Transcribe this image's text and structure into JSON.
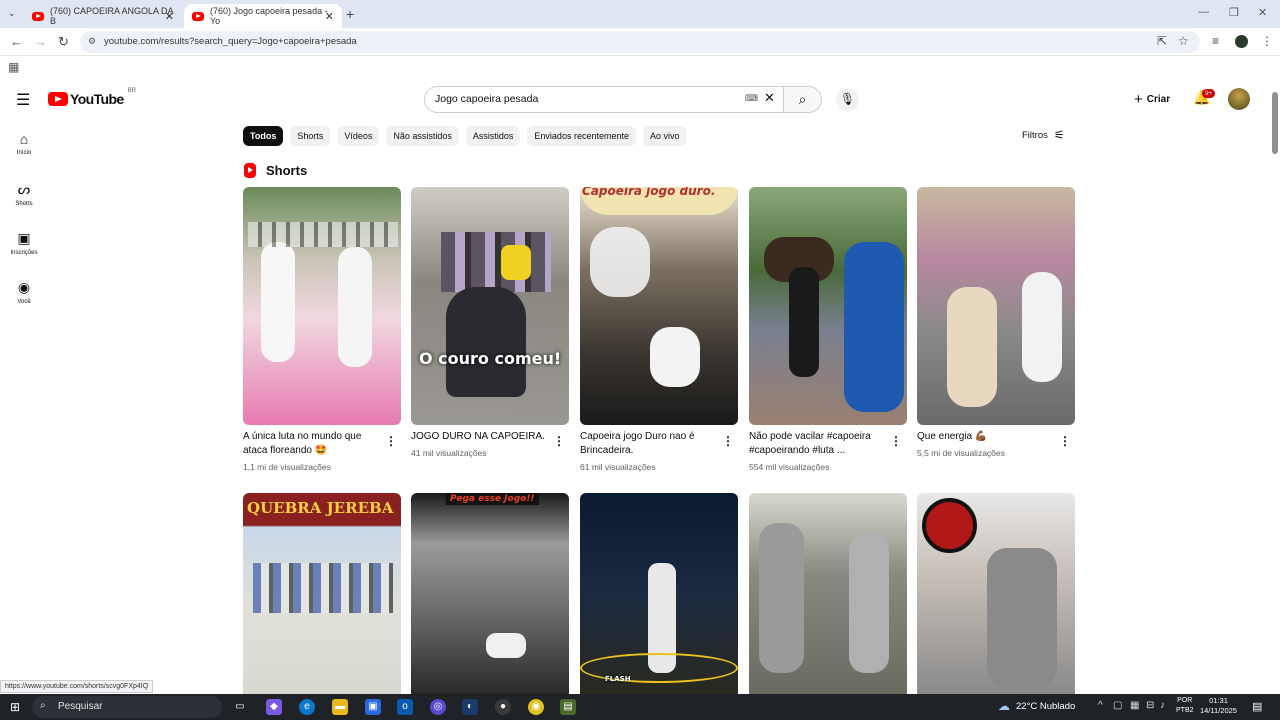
{
  "browser": {
    "tabs": [
      {
        "label": "(760) CAPOEIRA ANGOLA DA B",
        "favicon": "youtube-icon"
      },
      {
        "label": "(760) Jogo capoeira pesada - Yo",
        "favicon": "youtube-icon"
      }
    ],
    "url": "youtube.com/results?search_query=Jogo+capoeira+pesada"
  },
  "youtube": {
    "logo_text": "YouTube",
    "region": "BR",
    "search": {
      "value": "Jogo capoeira pesada"
    },
    "create_label": "Criar",
    "notification_badge": "9+"
  },
  "rail": [
    {
      "label": "Início",
      "icon": "home-icon"
    },
    {
      "label": "Shorts",
      "icon": "shorts-icon"
    },
    {
      "label": "Inscrições",
      "icon": "subscriptions-icon"
    },
    {
      "label": "Você",
      "icon": "you-icon"
    }
  ],
  "chips": [
    "Todos",
    "Shorts",
    "Vídeos",
    "Não assistidos",
    "Assistidos",
    "Enviados recentemente",
    "Ao vivo"
  ],
  "filters_label": "Filtros",
  "shorts_section_title": "Shorts",
  "shorts": [
    {
      "title": "A única luta no mundo que ataca floreando 🤩",
      "views": "1,1 mi de visualizações",
      "overlay": ""
    },
    {
      "title": "JOGO DURO NA CAPOEIRA.",
      "views": "41 mil visualizações",
      "overlay": "O couro comeu!"
    },
    {
      "title": "Capoeira jogo Duro nao é Brincadeira.",
      "views": "61 mil visualizações",
      "overlay": "Capoeira jogo duro."
    },
    {
      "title": "Não pode vacilar #capoeira #capoeirando #luta ...",
      "views": "554 mil visualizações",
      "overlay": ""
    },
    {
      "title": "Que energia 💪🏾",
      "views": "5,5 mi de visualizações",
      "overlay": ""
    }
  ],
  "shorts_row2_overlays": [
    "QUEBRA JEREBA",
    "Pega esse Jogo!!",
    "FLASH",
    "",
    ""
  ],
  "status_url": "https://www.youtube.com/shorts/scvg0FXp4IQ",
  "taskbar": {
    "search_placeholder": "Pesquisar",
    "weather": "22°C  Nublado",
    "lang_line1": "POR",
    "lang_line2": "PTB2",
    "time": "01:31",
    "date": "14/11/2025"
  }
}
